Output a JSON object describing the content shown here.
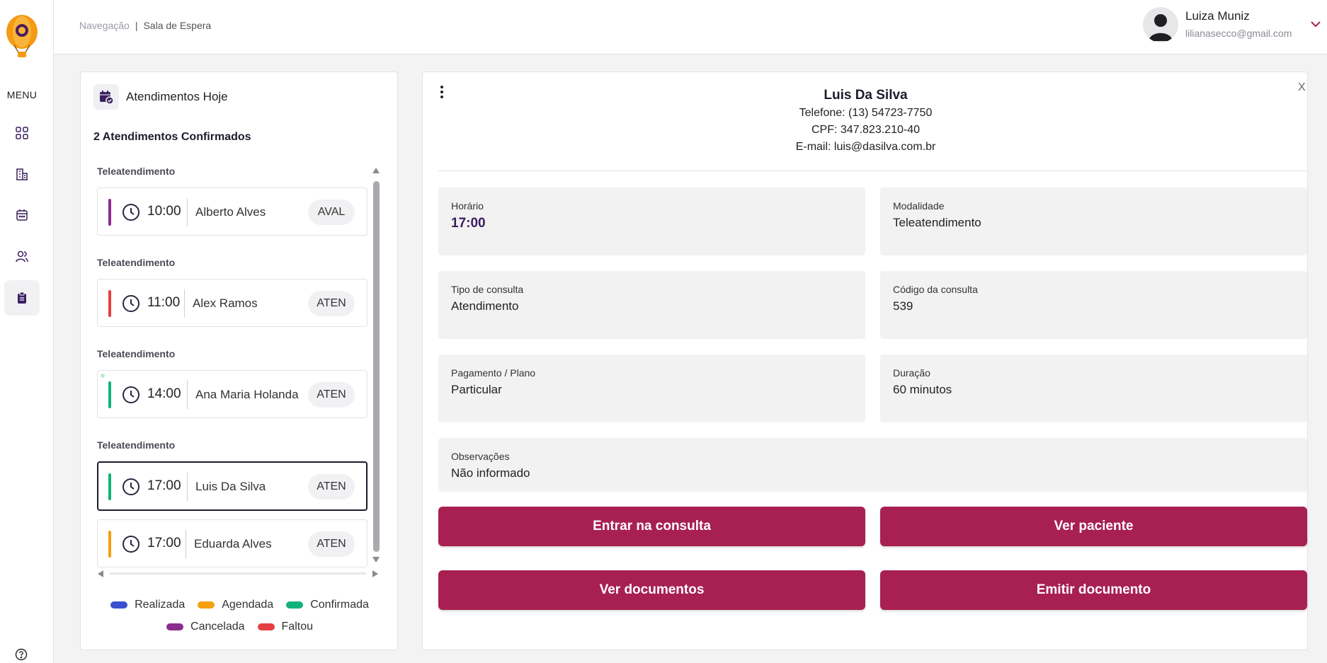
{
  "sidebar": {
    "menu_label": "MENU",
    "items": [
      {
        "icon": "grid-icon"
      },
      {
        "icon": "building-icon"
      },
      {
        "icon": "calendar-icon"
      },
      {
        "icon": "users-icon"
      },
      {
        "icon": "clipboard-icon",
        "active": true
      }
    ]
  },
  "header": {
    "breadcrumb_root": "Navegação",
    "breadcrumb_separator": "|",
    "breadcrumb_current": "Sala de Espera",
    "user_name": "Luiza Muniz",
    "user_email": "lilianasecco@gmail.com"
  },
  "appointments_panel": {
    "title": "Atendimentos Hoje",
    "count_text": "2 Atendimentos Confirmados",
    "items": [
      {
        "group": "Teleatendimento",
        "time": "10:00",
        "name": "Alberto Alves",
        "tag": "AVAL",
        "status_color": "#8b2c8f"
      },
      {
        "group": "Teleatendimento",
        "time": "11:00",
        "name": "Alex Ramos",
        "tag": "ATEN",
        "status_color": "#e53e44"
      },
      {
        "group": "Teleatendimento",
        "time": "14:00",
        "name": "Ana Maria Holanda",
        "tag": "ATEN",
        "status_color": "#10b37a"
      },
      {
        "group": "Teleatendimento",
        "time": "17:00",
        "name": "Luis Da Silva",
        "tag": "ATEN",
        "status_color": "#10b37a",
        "selected": true
      },
      {
        "group": "",
        "time": "17:00",
        "name": "Eduarda Alves",
        "tag": "ATEN",
        "status_color": "#f5a00f"
      }
    ],
    "legend": [
      {
        "label": "Realizada",
        "color": "#3a4fd0"
      },
      {
        "label": "Agendada",
        "color": "#f5a00f"
      },
      {
        "label": "Confirmada",
        "color": "#10b37a"
      },
      {
        "label": "Cancelada",
        "color": "#8b2c8f"
      },
      {
        "label": "Faltou",
        "color": "#e53e44"
      }
    ]
  },
  "detail": {
    "close_label": "X",
    "patient_name": "Luis Da Silva",
    "phone": "Telefone: (13) 54723-7750",
    "cpf": "CPF: 347.823.210-40",
    "email": "E-mail: luis@dasilva.com.br",
    "fields": {
      "horario": {
        "label": "Horário",
        "value": "17:00"
      },
      "modalidade": {
        "label": "Modalidade",
        "value": "Teleatendimento"
      },
      "tipo": {
        "label": "Tipo de consulta",
        "value": "Atendimento"
      },
      "codigo": {
        "label": "Código da consulta",
        "value": "539"
      },
      "pagamento": {
        "label": "Pagamento / Plano",
        "value": "Particular"
      },
      "duracao": {
        "label": "Duração",
        "value": "60 minutos"
      },
      "observacoes": {
        "label": "Observações",
        "value": "Não informado"
      }
    },
    "buttons": {
      "enter": "Entrar na consulta",
      "patient": "Ver paciente",
      "docs": "Ver documentos",
      "emit": "Emitir documento"
    },
    "accent_color": "#a82051"
  }
}
